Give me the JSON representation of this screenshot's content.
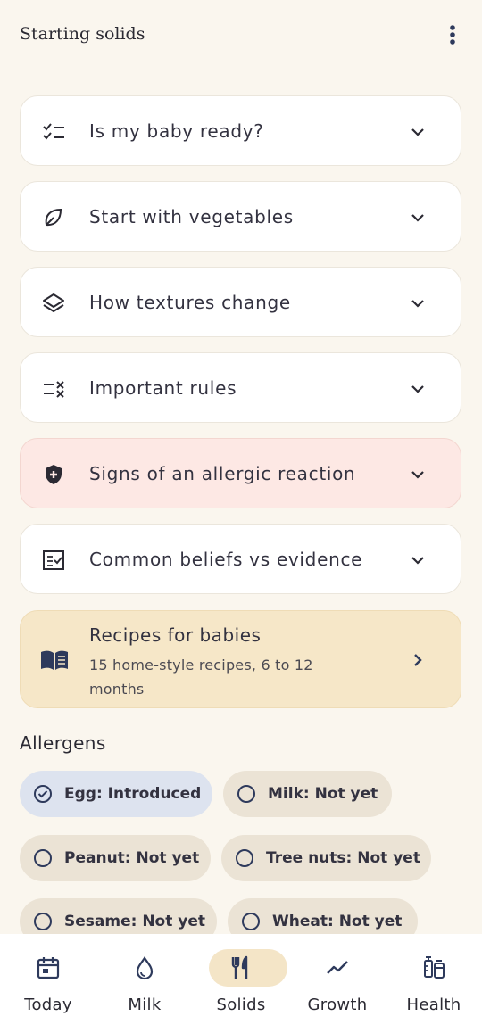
{
  "header": {
    "title": "Starting solids",
    "menu_icon": "more-vertical-icon"
  },
  "sections": [
    {
      "label": "Is my baby ready?",
      "icon": "checklist-icon"
    },
    {
      "label": "Start with vegetables",
      "icon": "leaf-icon"
    },
    {
      "label": "How textures change",
      "icon": "layers-icon"
    },
    {
      "label": "Important rules",
      "icon": "rule-list-icon"
    },
    {
      "label": "Signs of an allergic reaction",
      "icon": "shield-plus-icon",
      "highlight": "#fde8e4"
    },
    {
      "label": "Common beliefs vs evidence",
      "icon": "fact-check-icon"
    }
  ],
  "recipes": {
    "title": "Recipes for babies",
    "subtitle": "15 home-style recipes, 6 to 12 months",
    "icon": "open-book-icon"
  },
  "allergens": {
    "title": "Allergens",
    "chips": [
      {
        "label": "Egg: Introduced",
        "state": "introduced"
      },
      {
        "label": "Milk: Not yet",
        "state": "not-yet"
      },
      {
        "label": "Peanut: Not yet",
        "state": "not-yet"
      },
      {
        "label": "Tree nuts: Not yet",
        "state": "not-yet"
      },
      {
        "label": "Sesame: Not yet",
        "state": "not-yet"
      },
      {
        "label": "Wheat: Not yet",
        "state": "not-yet"
      }
    ]
  },
  "bottom_nav": {
    "items": [
      {
        "label": "Today",
        "icon": "calendar-icon"
      },
      {
        "label": "Milk",
        "icon": "drop-icon"
      },
      {
        "label": "Solids",
        "icon": "fork-knife-icon",
        "active": true
      },
      {
        "label": "Growth",
        "icon": "trend-icon"
      },
      {
        "label": "Health",
        "icon": "vaccine-icon"
      }
    ]
  },
  "colors": {
    "background": "#faf6ee",
    "card": "#ffffff",
    "alert_card": "#fde8e4",
    "recipe_card": "#f6e7c8",
    "chip": "#ebe3d5",
    "chip_active": "#dde3ef",
    "nav_active_pill": "#f4e5c7",
    "icon_navy": "#2e3a5c"
  }
}
